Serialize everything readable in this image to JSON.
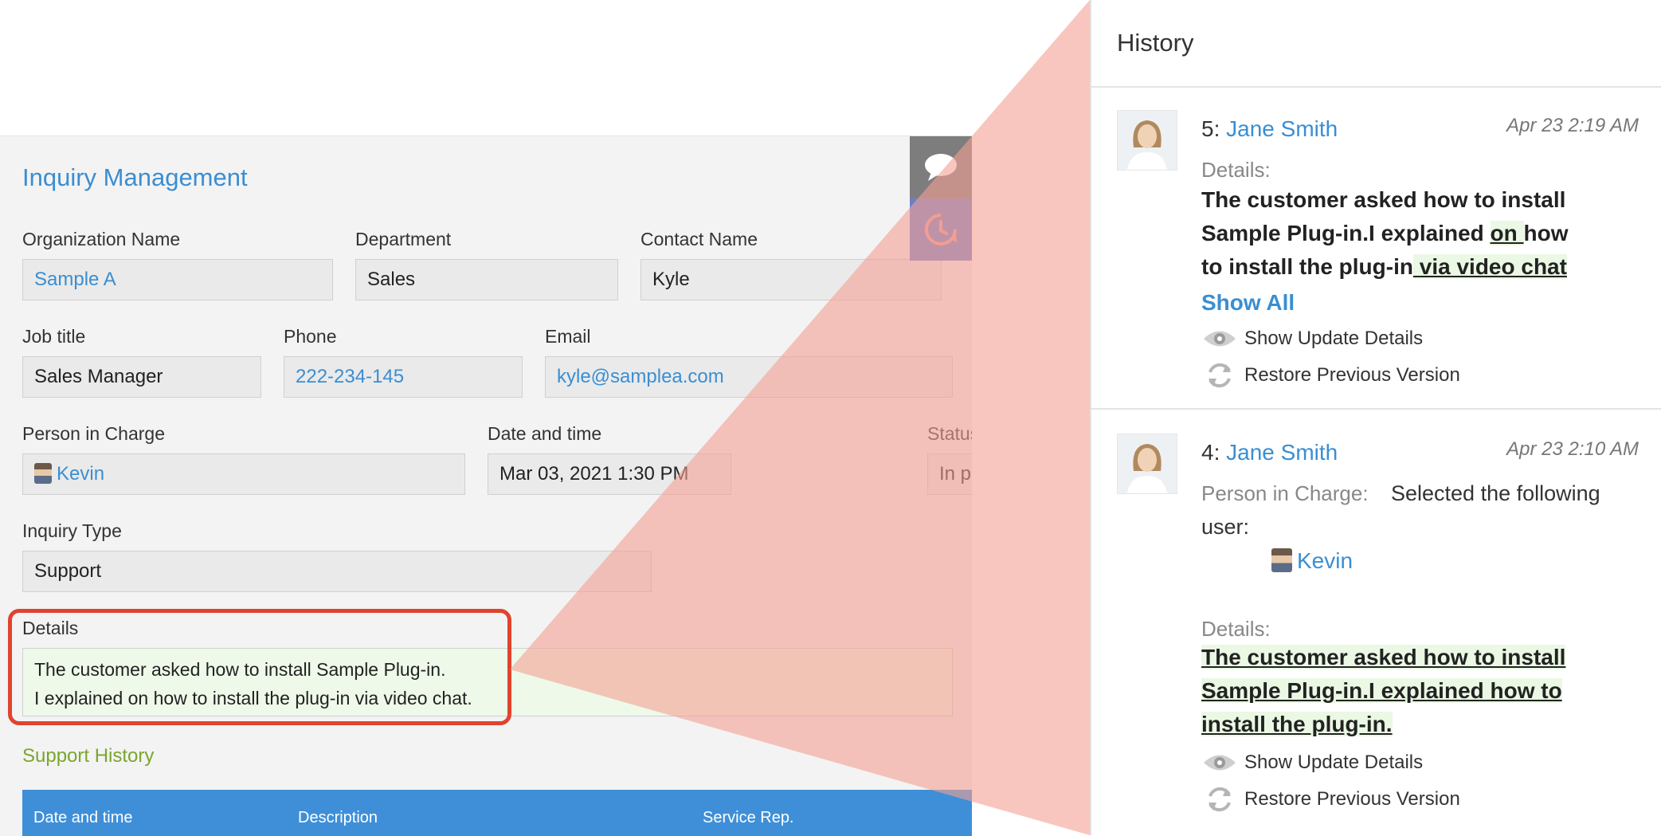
{
  "form": {
    "app_title": "Inquiry Management",
    "fields": {
      "organization_name": {
        "label": "Organization Name",
        "value": "Sample A"
      },
      "department": {
        "label": "Department",
        "value": "Sales"
      },
      "contact_name": {
        "label": "Contact Name",
        "value": "Kyle"
      },
      "job_title": {
        "label": "Job title",
        "value": "Sales Manager"
      },
      "phone": {
        "label": "Phone",
        "value": "222-234-145"
      },
      "email": {
        "label": "Email",
        "value": "kyle@samplea.com"
      },
      "person_in_charge": {
        "label": "Person in Charge",
        "value": "Kevin"
      },
      "date_and_time": {
        "label": "Date and time",
        "value": "Mar 03, 2021 1:30 PM"
      },
      "status": {
        "label": "Status",
        "value": "In p"
      },
      "inquiry_type": {
        "label": "Inquiry Type",
        "value": "Support"
      },
      "details": {
        "label": "Details",
        "line1": "The customer asked how to install Sample Plug-in.",
        "line2": "I explained on how to install the plug-in via video chat."
      }
    },
    "support_history": {
      "title": "Support History",
      "columns": [
        "Date and time",
        "Description",
        "Service Rep."
      ]
    },
    "side_buttons": {
      "comment_icon": "speech-bubble-icon",
      "history_icon": "history-clock-icon"
    }
  },
  "history": {
    "title": "History",
    "entries": [
      {
        "number": "5:",
        "author": "Jane Smith",
        "time": "Apr 23 2:19 AM",
        "details_label": "Details:",
        "line1": "The customer asked how to install",
        "line2_a": "Sample Plug-in.I explained ",
        "line2_ins": "on ",
        "line2_b": "how",
        "line3_a": "to install the plug-in",
        "line3_ins": " via video chat",
        "show_all": "Show All",
        "show_update": "Show Update Details",
        "restore": "Restore Previous Version"
      },
      {
        "number": "4:",
        "author": "Jane Smith",
        "time": "Apr 23 2:10 AM",
        "pic_label": "Person in Charge:",
        "pic_text1": "Selected the following",
        "pic_text2": "user:",
        "user": "Kevin",
        "details_label": "Details:",
        "line1": "The customer asked how to install",
        "line2": "Sample Plug-in.I explained how to",
        "line3": "install the plug-in.",
        "show_update": "Show Update Details",
        "restore": "Restore Previous Version"
      }
    ]
  },
  "colors": {
    "accent": "#3a8ed2",
    "highlight_frame": "#e0432e",
    "wedge": "#f4a092",
    "support_green": "#7aa62e"
  }
}
